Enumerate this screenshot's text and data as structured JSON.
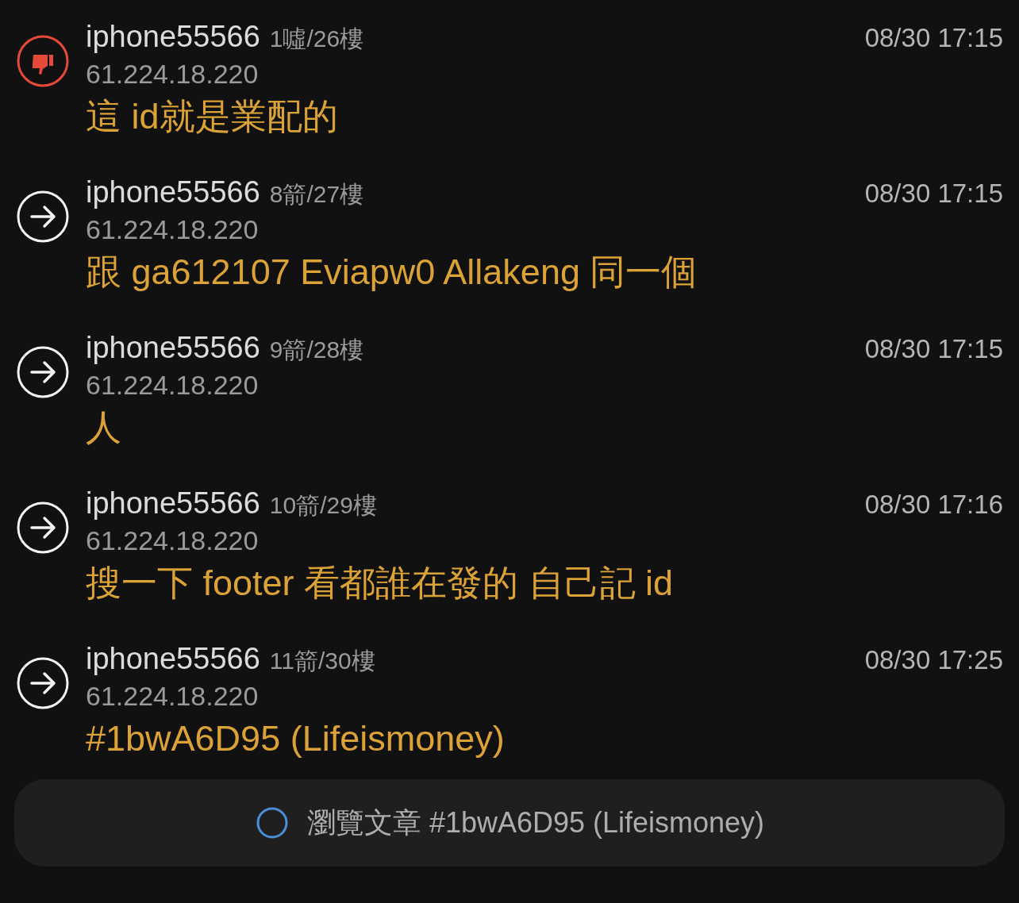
{
  "comments": [
    {
      "kind": "boo",
      "author": "iphone55566",
      "floor": "1噓/26樓",
      "time": "08/30 17:15",
      "ip": "61.224.18.220",
      "content": "這 id就是業配的"
    },
    {
      "kind": "arrow",
      "author": "iphone55566",
      "floor": "8箭/27樓",
      "time": "08/30 17:15",
      "ip": "61.224.18.220",
      "content": "跟 ga612107 Eviapw0 Allakeng 同一個"
    },
    {
      "kind": "arrow",
      "author": "iphone55566",
      "floor": "9箭/28樓",
      "time": "08/30 17:15",
      "ip": "61.224.18.220",
      "content": "人"
    },
    {
      "kind": "arrow",
      "author": "iphone55566",
      "floor": "10箭/29樓",
      "time": "08/30 17:16",
      "ip": "61.224.18.220",
      "content": "搜一下 footer 看都誰在發的 自己記 id"
    },
    {
      "kind": "arrow",
      "author": "iphone55566",
      "floor": "11箭/30樓",
      "time": "08/30 17:25",
      "ip": "61.224.18.220",
      "content": "#1bwA6D95 (Lifeismoney)"
    }
  ],
  "footer_button": {
    "label": "瀏覽文章 #1bwA6D95 (Lifeismoney)"
  }
}
